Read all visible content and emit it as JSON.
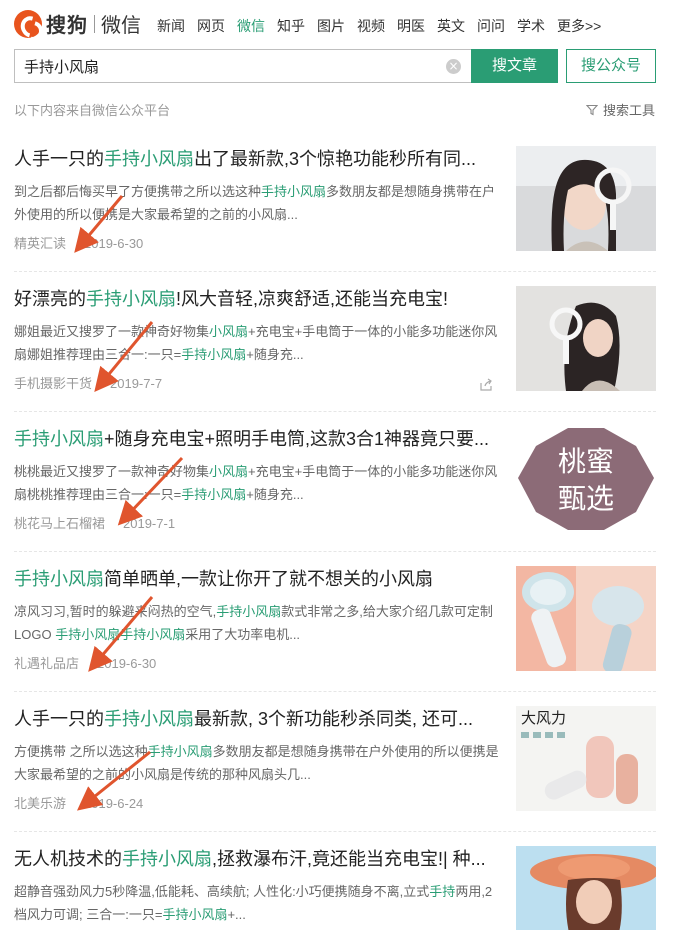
{
  "brand": {
    "logo_text": "搜狗",
    "logo_sub": "微信"
  },
  "nav": {
    "items": [
      {
        "label": "新闻",
        "active": false
      },
      {
        "label": "网页",
        "active": false
      },
      {
        "label": "微信",
        "active": true
      },
      {
        "label": "知乎",
        "active": false
      },
      {
        "label": "图片",
        "active": false
      },
      {
        "label": "视频",
        "active": false
      },
      {
        "label": "明医",
        "active": false
      },
      {
        "label": "英文",
        "active": false
      },
      {
        "label": "问问",
        "active": false
      },
      {
        "label": "学术",
        "active": false
      },
      {
        "label": "更多>>",
        "active": false
      }
    ]
  },
  "search": {
    "query": "手持小风扇",
    "clear_icon": "clear-icon",
    "search_article_label": "搜文章",
    "search_account_label": "搜公众号"
  },
  "source_note": "以下内容来自微信公众平台",
  "tools_label": "搜索工具",
  "colors": {
    "accent": "#2a9d74",
    "arrow": "#e0552e"
  },
  "results": [
    {
      "title_html": "人手一只的<span class=\"hl\">手持小风扇</span>出了最新款,3个惊艳功能秒所有同...",
      "desc_html": "到之后都后悔买早了方便携带之所以选这种<span class=\"hl\">手持小风扇</span>多数朋友都是想随身携带在户外使用的所以便携是大家最希望的之前的小风扇...",
      "source": "精英汇读",
      "date": "2019-6-30",
      "thumb": "woman-with-fan-photo"
    },
    {
      "title_html": "好漂亮的<span class=\"hl\">手持小风扇</span>!风大音轻,凉爽舒适,还能当充电宝!",
      "desc_html": "娜姐最近又搜罗了一款神奇好物集<span class=\"hl\">小风扇</span>+充电宝+手电筒于一体的小能多功能迷你风扇娜姐推荐理由三合一:一只=<span class=\"hl\">手持小风扇</span>+随身充...",
      "source": "手机摄影干货",
      "date": "2019-7-7",
      "thumb": "woman-with-fan-photo-2"
    },
    {
      "title_html": "<span class=\"hl\">手持小风扇</span>+随身充电宝+照明手电筒,这款3合1神器竟只要...",
      "desc_html": "桃桃最近又搜罗了一款神奇好物集<span class=\"hl\">小风扇</span>+充电宝+手电筒于一体的小能多功能迷你风扇桃桃推荐理由三合一:一只=<span class=\"hl\">手持小风扇</span>+随身充...",
      "source": "桃花马上石榴裙",
      "date": "2019-7-1",
      "thumb": "brand-badge",
      "badge_line1": "桃蜜",
      "badge_line2": "甄选"
    },
    {
      "title_html": "<span class=\"hl\">手持小风扇</span>简单晒单,一款让你开了就不想关的小风扇",
      "desc_html": "凉风习习,暂时的躲避来闷热的空气,<span class=\"hl\">手持小风扇</span>款式非常之多,给大家介绍几款可定制LOGO <span class=\"hl\">手持小风扇手持小风扇</span>采用了大功率电机...",
      "source": "礼遇礼品店",
      "date": "2019-6-30",
      "thumb": "pink-fan-product-photo"
    },
    {
      "title_html": "人手一只的<span class=\"hl\">手持小风扇</span>最新款, 3个新功能秒杀同类, 还可...",
      "desc_html": "方便携带 之所以选这种<span class=\"hl\">手持小风扇</span>多数朋友都是想随身携带在户外使用的所以便携是大家最希望的之前的小风扇是传统的那种风扇头几...",
      "source": "北美乐游",
      "date": "2019-6-24",
      "thumb": "fan-product-ad",
      "thumb_caption": "大风力"
    },
    {
      "title_html": "无人机技术的<span class=\"hl\">手持小风扇</span>,拯救瀑布汗,竟还能当充电宝!| 种...",
      "desc_html": "超静音强劲风力5秒降温,低能耗、高续航; 人性化:小巧便携随身不离,立式<span class=\"hl\">手持</span>两用,2档风力可调; 三合一:一只=<span class=\"hl\">手持小风扇</span>+...",
      "source": "",
      "date": "",
      "thumb": "woman-in-hat-photo"
    }
  ]
}
